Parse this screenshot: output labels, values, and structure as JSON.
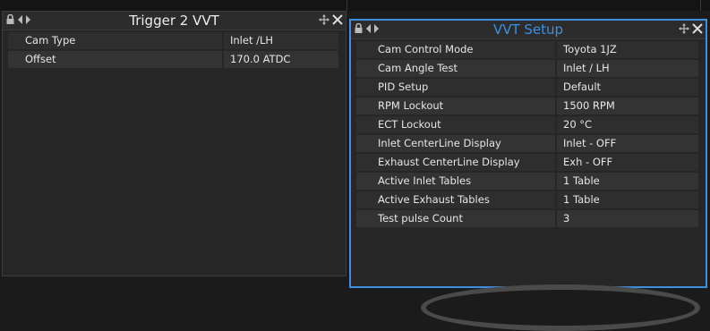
{
  "trigger_panel": {
    "title": "Trigger 2 VVT",
    "rows": [
      {
        "label": "Cam Type",
        "value": "Inlet /LH"
      },
      {
        "label": "Offset",
        "value": "170.0 ATDC"
      }
    ]
  },
  "vvt_panel": {
    "title": "VVT Setup",
    "rows": [
      {
        "label": "Cam Control Mode",
        "value": "Toyota 1JZ"
      },
      {
        "label": "Cam Angle Test",
        "value": "Inlet / LH"
      },
      {
        "label": "PID Setup",
        "value": "Default"
      },
      {
        "label": "RPM Lockout",
        "value": "1500 RPM"
      },
      {
        "label": "ECT Lockout",
        "value": "20 °C"
      },
      {
        "label": "Inlet CenterLine Display",
        "value": "Inlet - OFF"
      },
      {
        "label": "Exhaust CenterLine Display",
        "value": "Exh - OFF"
      },
      {
        "label": "Active Inlet Tables",
        "value": "1 Table"
      },
      {
        "label": "Active Exhaust Tables",
        "value": "1 Table"
      },
      {
        "label": "Test pulse Count",
        "value": "3"
      }
    ]
  },
  "colors": {
    "accent": "#3d8fe0",
    "panel_bg": "#262626",
    "row_bg": "#2e2e2e",
    "text": "#e6e6e6"
  },
  "icons": [
    "lock-icon",
    "arrow-left-icon",
    "arrow-right-icon",
    "move-icon",
    "close-icon"
  ]
}
